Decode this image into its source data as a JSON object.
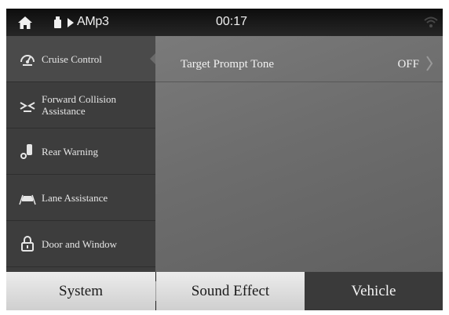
{
  "status_bar": {
    "home_icon": "home-icon",
    "usb_icon": "usb-icon",
    "play_icon": "play-icon",
    "source": "AMp3",
    "time": "00:17",
    "signal_icon": "wifi-signal-icon"
  },
  "sidebar": {
    "items": [
      {
        "label": "Cruise Control",
        "icon": "speedometer-icon",
        "active": true
      },
      {
        "label": "Forward Collision Assistance",
        "icon": "collision-icon",
        "active": false
      },
      {
        "label": "Rear Warning",
        "icon": "rear-warning-icon",
        "active": false
      },
      {
        "label": "Lane Assistance",
        "icon": "lane-icon",
        "active": false
      },
      {
        "label": "Door and Window",
        "icon": "lock-icon",
        "active": false
      }
    ]
  },
  "content": {
    "settings": [
      {
        "label": "Target Prompt Tone",
        "value": "OFF"
      }
    ]
  },
  "tabs": [
    {
      "label": "System",
      "active": false
    },
    {
      "label": "Sound Effect",
      "active": false
    },
    {
      "label": "Vehicle",
      "active": true
    }
  ],
  "colors": {
    "status_bar": "#1a1a1a",
    "sidebar": "#3d3d3d",
    "content": "#707070",
    "tab_inactive": "#dcdcdc",
    "tab_active": "#3a3a3a"
  }
}
